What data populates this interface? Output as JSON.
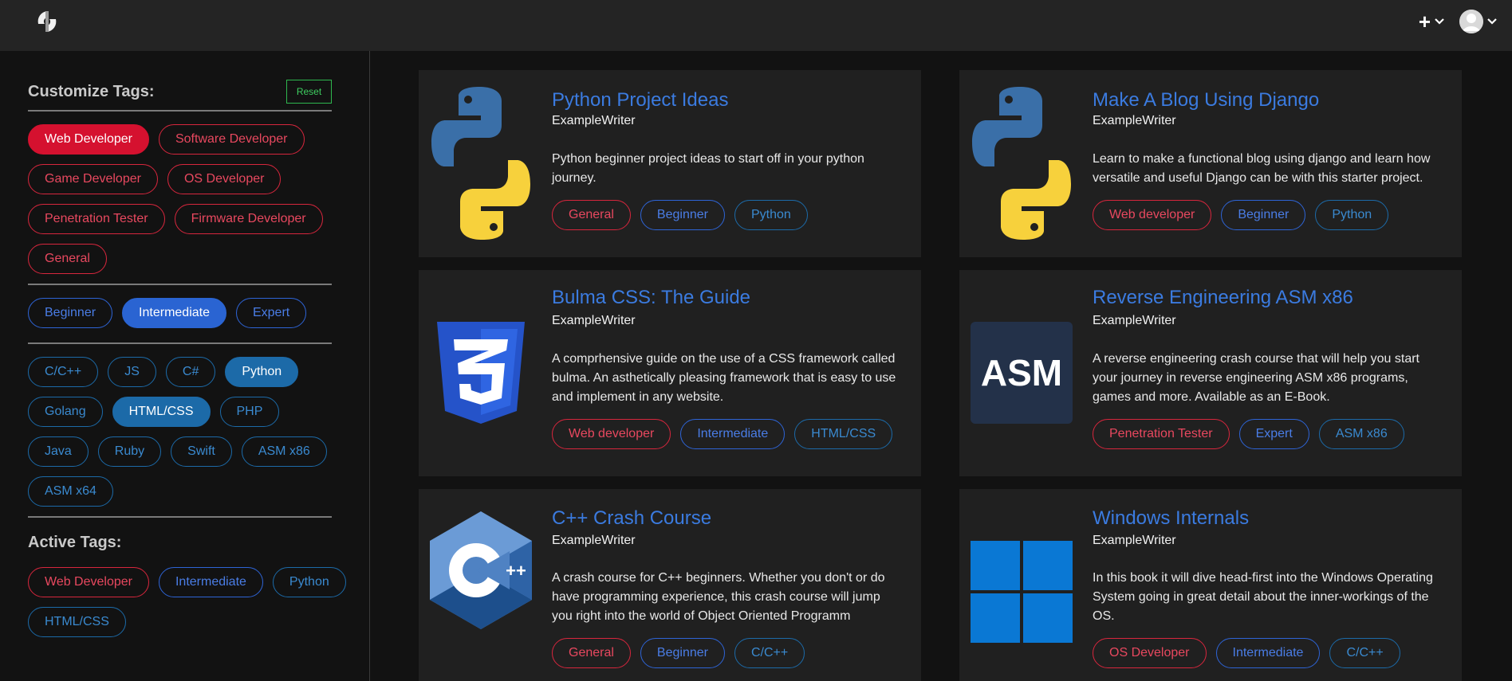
{
  "sidebar": {
    "title": "Customize Tags:",
    "reset_label": "Reset",
    "role_tags": [
      {
        "label": "Web Developer",
        "on": true
      },
      {
        "label": "Software Developer",
        "on": false
      },
      {
        "label": "Game Developer",
        "on": false
      },
      {
        "label": "OS Developer",
        "on": false
      },
      {
        "label": "Penetration Tester",
        "on": false
      },
      {
        "label": "Firmware Developer",
        "on": false
      },
      {
        "label": "General",
        "on": false
      }
    ],
    "level_tags": [
      {
        "label": "Beginner",
        "on": false
      },
      {
        "label": "Intermediate",
        "on": true
      },
      {
        "label": "Expert",
        "on": false
      }
    ],
    "lang_tags": [
      {
        "label": "C/C++",
        "on": false
      },
      {
        "label": "JS",
        "on": false
      },
      {
        "label": "C#",
        "on": false
      },
      {
        "label": "Python",
        "on": true
      },
      {
        "label": "Golang",
        "on": false
      },
      {
        "label": "HTML/CSS",
        "on": true
      },
      {
        "label": "PHP",
        "on": false
      },
      {
        "label": "Java",
        "on": false
      },
      {
        "label": "Ruby",
        "on": false
      },
      {
        "label": "Swift",
        "on": false
      },
      {
        "label": "ASM x86",
        "on": false
      },
      {
        "label": "ASM x64",
        "on": false
      }
    ],
    "active_title": "Active Tags:",
    "active_tags": [
      {
        "label": "Web Developer",
        "kind": "red"
      },
      {
        "label": "Intermediate",
        "kind": "blue"
      },
      {
        "label": "Python",
        "kind": "teal"
      },
      {
        "label": "HTML/CSS",
        "kind": "teal"
      }
    ]
  },
  "cards": [
    {
      "title": "Python Project Ideas",
      "author": "ExampleWriter",
      "description": "Python beginner project ideas to start off in your python journey.",
      "icon": "python-logo-icon",
      "tags": [
        {
          "label": "General",
          "kind": "red"
        },
        {
          "label": "Beginner",
          "kind": "blue"
        },
        {
          "label": "Python",
          "kind": "teal"
        }
      ]
    },
    {
      "title": "Make A Blog Using Django",
      "author": "ExampleWriter",
      "description": "Learn to make a functional blog using django and learn how versatile and useful Django can be with this starter project.",
      "icon": "python-logo-icon",
      "tags": [
        {
          "label": "Web developer",
          "kind": "red"
        },
        {
          "label": "Beginner",
          "kind": "blue"
        },
        {
          "label": "Python",
          "kind": "teal"
        }
      ]
    },
    {
      "title": "Bulma CSS: The Guide",
      "author": "ExampleWriter",
      "description": "A comprhensive guide on the use of a CSS framework called bulma. An asthetically pleasing framework that is easy to use and implement in any website.",
      "icon": "css3-logo-icon",
      "tags": [
        {
          "label": "Web developer",
          "kind": "red"
        },
        {
          "label": "Intermediate",
          "kind": "blue"
        },
        {
          "label": "HTML/CSS",
          "kind": "teal"
        }
      ]
    },
    {
      "title": "Reverse Engineering ASM x86",
      "author": "ExampleWriter",
      "description": "A reverse engineering crash course that will help you start your journey in reverse engineering ASM x86 programs, games and more. Available as an E-Book.",
      "icon": "asm-logo-icon",
      "icon_text": "ASM",
      "tags": [
        {
          "label": "Penetration Tester",
          "kind": "red"
        },
        {
          "label": "Expert",
          "kind": "blue"
        },
        {
          "label": "ASM x86",
          "kind": "teal"
        }
      ]
    },
    {
      "title": "C++ Crash Course",
      "author": "ExampleWriter",
      "description": "A crash course for C++ beginners. Whether you don't or do have programming experience, this crash course will jump you right into the world of Object Oriented Programm",
      "icon": "cpp-logo-icon",
      "tags": [
        {
          "label": "General",
          "kind": "red"
        },
        {
          "label": "Beginner",
          "kind": "blue"
        },
        {
          "label": "C/C++",
          "kind": "teal"
        }
      ]
    },
    {
      "title": "Windows Internals",
      "author": "ExampleWriter",
      "description": "In this book it will dive head-first into the Windows Operating System going in great detail about the inner-workings of the OS.",
      "icon": "windows-logo-icon",
      "tags": [
        {
          "label": "OS Developer",
          "kind": "red"
        },
        {
          "label": "Intermediate",
          "kind": "blue"
        },
        {
          "label": "C/C++",
          "kind": "teal"
        }
      ]
    }
  ],
  "navbar": {
    "logo_icon": "site-logo-icon",
    "create_icon": "plus-icon",
    "account_icon": "user-avatar"
  }
}
